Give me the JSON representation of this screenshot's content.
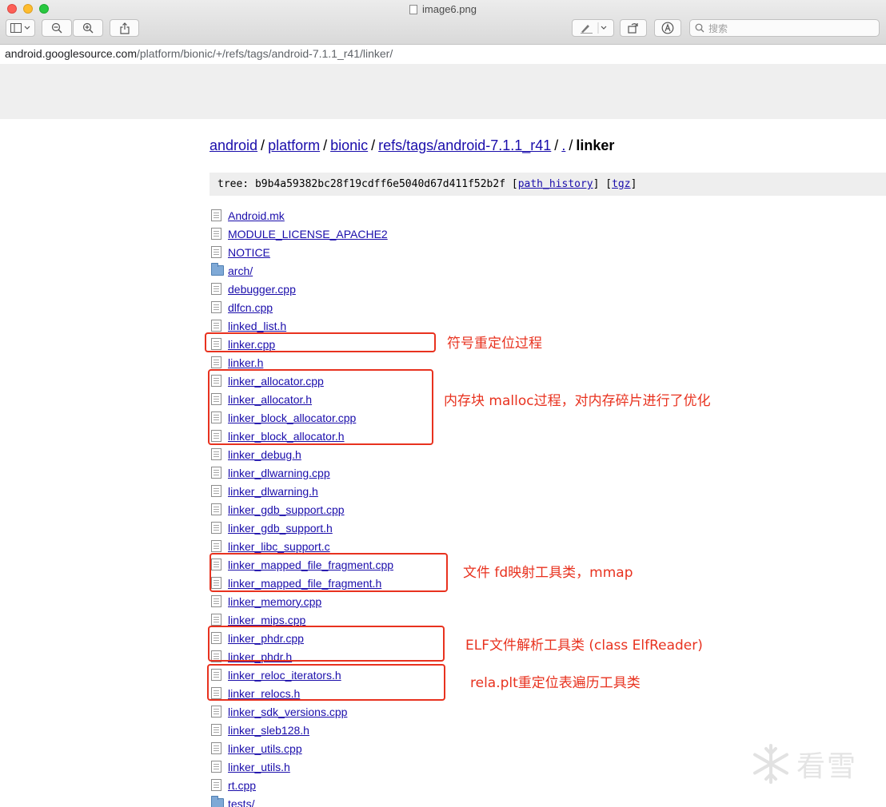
{
  "window": {
    "title": "image6.png",
    "search_placeholder": "搜索",
    "icons": [
      "sidebar-icon",
      "zoom-out-icon",
      "zoom-in-icon",
      "share-icon",
      "markup-icon",
      "rotate-icon",
      "annotate-icon",
      "search-icon"
    ]
  },
  "url": {
    "host": "android.googlesource.com",
    "path": "/platform/bionic/+/refs/tags/android-7.1.1_r41/linker/"
  },
  "breadcrumb": {
    "items": [
      "android",
      "platform",
      "bionic",
      "refs/tags/android-7.1.1_r41",
      "."
    ],
    "separator": "/",
    "current": "linker"
  },
  "tree": {
    "prefix": "tree: ",
    "hash": "b9b4a59382bc28f19cdff6e5040d67d411f52b2f",
    "links": [
      "path_history",
      "tgz"
    ]
  },
  "files": [
    {
      "name": "Android.mk",
      "type": "file"
    },
    {
      "name": "MODULE_LICENSE_APACHE2",
      "type": "file"
    },
    {
      "name": "NOTICE",
      "type": "file"
    },
    {
      "name": "arch/",
      "type": "folder"
    },
    {
      "name": "debugger.cpp",
      "type": "file"
    },
    {
      "name": "dlfcn.cpp",
      "type": "file"
    },
    {
      "name": "linked_list.h",
      "type": "file"
    },
    {
      "name": "linker.cpp",
      "type": "file"
    },
    {
      "name": "linker.h",
      "type": "file"
    },
    {
      "name": "linker_allocator.cpp",
      "type": "file"
    },
    {
      "name": "linker_allocator.h",
      "type": "file"
    },
    {
      "name": "linker_block_allocator.cpp",
      "type": "file"
    },
    {
      "name": "linker_block_allocator.h",
      "type": "file"
    },
    {
      "name": "linker_debug.h",
      "type": "file"
    },
    {
      "name": "linker_dlwarning.cpp",
      "type": "file"
    },
    {
      "name": "linker_dlwarning.h",
      "type": "file"
    },
    {
      "name": "linker_gdb_support.cpp",
      "type": "file"
    },
    {
      "name": "linker_gdb_support.h",
      "type": "file"
    },
    {
      "name": "linker_libc_support.c",
      "type": "file"
    },
    {
      "name": "linker_mapped_file_fragment.cpp",
      "type": "file"
    },
    {
      "name": "linker_mapped_file_fragment.h",
      "type": "file"
    },
    {
      "name": "linker_memory.cpp",
      "type": "file"
    },
    {
      "name": "linker_mips.cpp",
      "type": "file"
    },
    {
      "name": "linker_phdr.cpp",
      "type": "file"
    },
    {
      "name": "linker_phdr.h",
      "type": "file"
    },
    {
      "name": "linker_reloc_iterators.h",
      "type": "file"
    },
    {
      "name": "linker_relocs.h",
      "type": "file"
    },
    {
      "name": "linker_sdk_versions.cpp",
      "type": "file"
    },
    {
      "name": "linker_sleb128.h",
      "type": "file"
    },
    {
      "name": "linker_utils.cpp",
      "type": "file"
    },
    {
      "name": "linker_utils.h",
      "type": "file"
    },
    {
      "name": "rt.cpp",
      "type": "file"
    },
    {
      "name": "tests/",
      "type": "folder"
    }
  ],
  "annotations": [
    "符号重定位过程",
    "内存块 malloc过程，对内存碎片进行了优化",
    "文件 fd映射工具类，mmap",
    "ELF文件解析工具类 (class ElfReader)",
    "rela.plt重定位表遍历工具类"
  ],
  "annotation_color": "#e8321f",
  "link_color": "#1a0dab",
  "watermark": "看雪"
}
